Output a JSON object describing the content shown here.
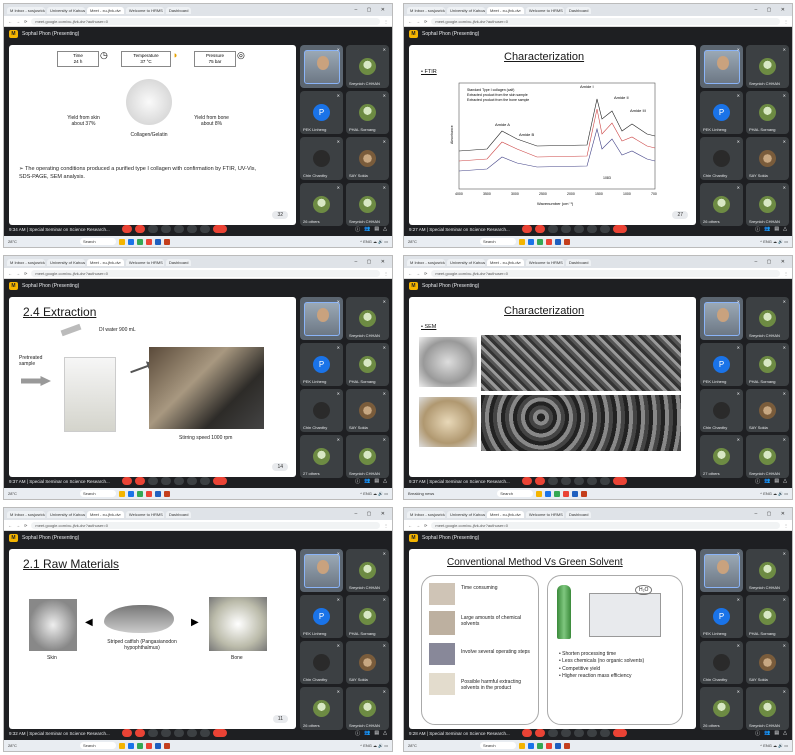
{
  "chrome": {
    "tabs": [
      "M Inbox - sosjusridu@",
      "University of Kahoaam",
      "Meet - xu-jfvk-dvr",
      "Welcome to HRMS",
      "Dashboard"
    ],
    "url": "meet.google.com/xu-jfvk-dvr?authuser=0"
  },
  "meet": {
    "presenter": "Sophal Phon (Presenting)",
    "time_a": "9:34 AM",
    "time_b": "9:27 AM",
    "time_c": "9:32 AM",
    "time_d": "9:26 AM",
    "time_e": "9:37 AM",
    "time_f": "9:28 AM",
    "meeting": "Special Seminar on Science Research...",
    "participants": [
      {
        "name": "Sophal Phon",
        "type": "self"
      },
      {
        "name": "Sreynich CHHAN",
        "type": "img"
      },
      {
        "name": "PEK Linheng",
        "type": "p",
        "initial": "P"
      },
      {
        "name": "PHAL Sornang",
        "type": "img"
      },
      {
        "name": "Chin Chanthy",
        "type": "dark"
      },
      {
        "name": "SAY Sokla",
        "type": "cat"
      },
      {
        "name": "26 others",
        "type": "group"
      },
      {
        "name": "Sreynich CHHAN",
        "type": "img"
      }
    ],
    "others_counts": [
      "26 others",
      "26 others",
      "27 others",
      "27 others",
      "26 others",
      "26 others"
    ]
  },
  "taskbar": {
    "search": "Search",
    "weather_a": "Breaking news",
    "weather_b": "28°C"
  },
  "slides": {
    "s1": {
      "time_label": "Time",
      "time_val": "24 h",
      "temp_label": "Temperature",
      "temp_val": "37 °C",
      "pressure_label": "Pressure",
      "pressure_val": "75 bar",
      "skin": "Yield from skin about 37%",
      "bone": "Yield from bone about 8%",
      "center": "Collagen/Gelatin",
      "note": "➢ The operating conditions produced a purified type I collagen with confirmation by FTIR, UV-Vis, SDS-PAGE, SEM analysis.",
      "page": "32"
    },
    "s2": {
      "title": "Characterization",
      "bullet": "FTIR",
      "legend": [
        "Standard Type I collagen (calf)",
        "Extracted product from the skin sample",
        "Extracted product from the bone sample"
      ],
      "labels": [
        "Amide I",
        "Amide II",
        "Amide III",
        "Amide A",
        "Amide B",
        "1083"
      ],
      "xlabel": "Wavenumber (cm⁻¹)",
      "ylabel": "Absorbance",
      "page": "27",
      "xticks": [
        "4000",
        "3500",
        "3000",
        "2500",
        "2000",
        "1500",
        "1000",
        "700"
      ]
    },
    "s3": {
      "title": "2.4 Extraction",
      "di": "DI water 900 mL",
      "pre": "Pretreated sample",
      "stir": "Stirring speed 1000 rpm",
      "page": "14"
    },
    "s4": {
      "title": "Characterization",
      "bullet": "SEM",
      "page": ""
    },
    "s5": {
      "title": "2.1 Raw Materials",
      "skin": "Skin",
      "fish": "Striped catfish (Pangasianodon hypophthalmus)",
      "bone": "Bone",
      "page": "11"
    },
    "s6": {
      "title": "Conventional Method Vs Green Solvent",
      "left": [
        "Time consuming",
        "Large amounts of chemical solvents",
        "Involve several operating steps",
        "Possible harmful extracting solvents in the product"
      ],
      "right": [
        "Shorten processing time",
        "Less chemicals (no organic solvents)",
        "Competitive yield",
        "Higher reaction mass efficiency"
      ],
      "h2o": "H₂O"
    }
  }
}
